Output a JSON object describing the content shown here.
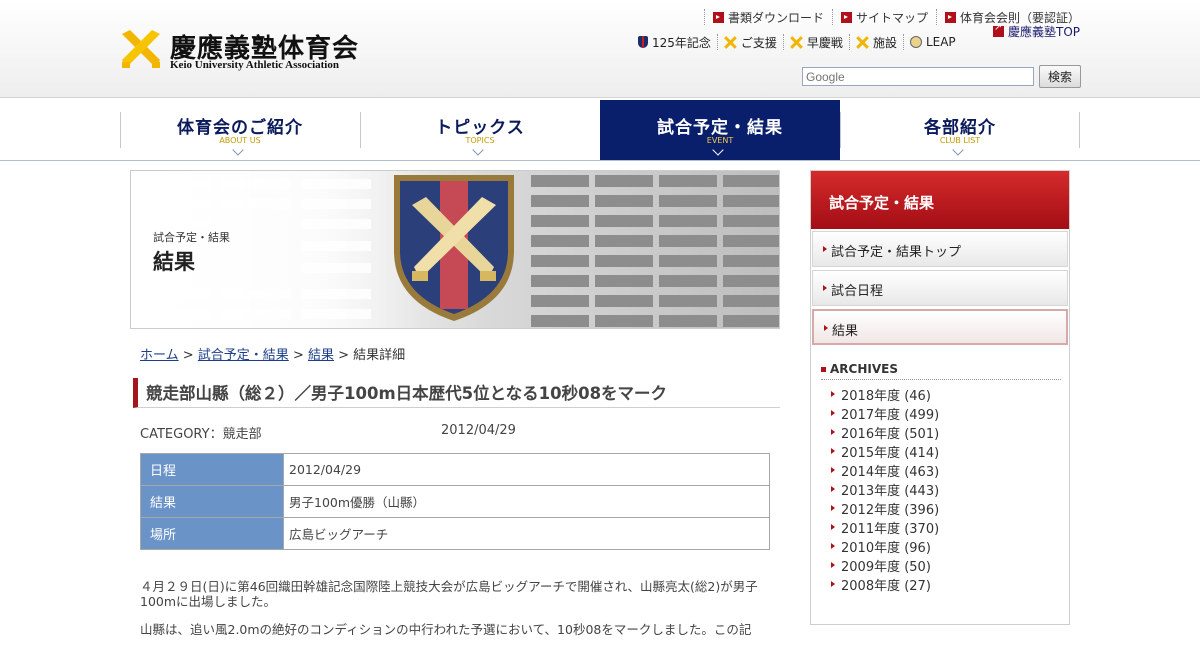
{
  "header": {
    "logo_jp": "慶應義塾体育会",
    "logo_en": "Keio University Athletic Association",
    "top_links": [
      {
        "label": "書類ダウンロード",
        "icon": "red-square-arrow-icon"
      },
      {
        "label": "サイトマップ",
        "icon": "red-square-arrow-icon"
      },
      {
        "label": "体育会会則（要認証）",
        "icon": "red-square-arrow-icon"
      }
    ],
    "keio_top": {
      "label": "慶應義塾TOP",
      "icon": "external-link-icon"
    },
    "sub_links": [
      {
        "label": "125年記念",
        "icon": "shield-icon"
      },
      {
        "label": "ご支援",
        "icon": "pen-cross-icon"
      },
      {
        "label": "早慶戦",
        "icon": "pen-cross-icon"
      },
      {
        "label": "施設",
        "icon": "pen-cross-icon"
      },
      {
        "label": "LEAP",
        "icon": "emblem-icon"
      }
    ],
    "search": {
      "placeholder": "Google",
      "button": "検索"
    }
  },
  "nav": [
    {
      "jp": "体育会のご紹介",
      "en": "ABOUT US",
      "active": false
    },
    {
      "jp": "トピックス",
      "en": "TOPICS",
      "active": false
    },
    {
      "jp": "試合予定・結果",
      "en": "EVENT",
      "active": true
    },
    {
      "jp": "各部紹介",
      "en": "CLUB LIST",
      "active": false
    }
  ],
  "hero": {
    "subtitle": "試合予定・結果",
    "title": "結果"
  },
  "breadcrumb": {
    "home": "ホーム",
    "sep": " > ",
    "level1": "試合予定・結果",
    "level2": "結果",
    "current": "結果詳細"
  },
  "article": {
    "title": "競走部山縣（総２）／男子100m日本歴代5位となる10秒08をマーク",
    "category": "CATEGORY：競走部",
    "date": "2012/04/29",
    "rows": [
      {
        "label": "日程",
        "value": "2012/04/29"
      },
      {
        "label": "結果",
        "value": "男子100m優勝（山縣）"
      },
      {
        "label": "場所",
        "value": "広島ビッグアーチ"
      }
    ],
    "paragraphs": [
      "４月２９日(日)に第46回織田幹雄記念国際陸上競技大会が広島ビッグアーチで開催され、山縣亮太(総2)が男子100mに出場しました。",
      "山縣は、追い風2.0mの絶好のコンディションの中行われた予選において、10秒08をマークしました。この記"
    ]
  },
  "sidebar": {
    "heading": "試合予定・結果",
    "items": [
      {
        "label": "試合予定・結果トップ",
        "active": false
      },
      {
        "label": "試合日程",
        "active": false
      },
      {
        "label": "結果",
        "active": true
      }
    ],
    "archives_title": "ARCHIVES",
    "archives": [
      "2018年度 (46)",
      "2017年度 (499)",
      "2016年度 (501)",
      "2015年度 (414)",
      "2014年度 (463)",
      "2013年度 (443)",
      "2012年度 (396)",
      "2011年度 (370)",
      "2010年度 (96)",
      "2009年度 (50)",
      "2008年度 (27)"
    ]
  },
  "colors": {
    "nav_active_bg": "#0a1f6b",
    "brand_red": "#b0101a",
    "table_header_bg": "#6a93c7",
    "logo_gold": "#f2b500"
  }
}
